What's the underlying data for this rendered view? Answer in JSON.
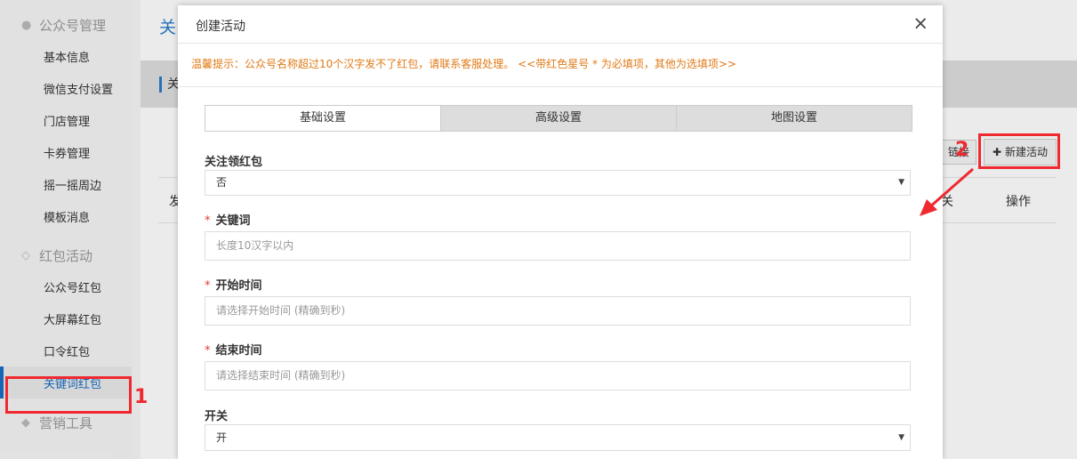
{
  "sidebar": {
    "groups": [
      {
        "label": "公众号管理",
        "items": [
          "基本信息",
          "微信支付设置",
          "门店管理",
          "卡券管理",
          "摇一摇周边",
          "模板消息"
        ]
      },
      {
        "label": "红包活动",
        "items": [
          "公众号红包",
          "大屏幕红包",
          "口令红包",
          "关键词红包"
        ]
      },
      {
        "label": "营销工具",
        "items": []
      }
    ]
  },
  "main": {
    "title": "关",
    "band_title": "关",
    "btn_link": "链接",
    "btn_new": "新建活动",
    "th_left": "发",
    "th_mid": "关",
    "th_op": "操作"
  },
  "modal": {
    "title": "创建活动",
    "close": "×",
    "notice": "温馨提示：公众号名称超过10个汉字发不了红包，请联系客服处理。 <<带红色星号 * 为必填项，其他为选填项>>",
    "tabs": [
      "基础设置",
      "高级设置",
      "地图设置"
    ],
    "active_tab": 0,
    "fields": {
      "follow": {
        "label": "关注领红包",
        "value": "否"
      },
      "keyword": {
        "label": "关键词",
        "placeholder": "长度10汉字以内"
      },
      "start": {
        "label": "开始时间",
        "placeholder": "请选择开始时间 (精确到秒)"
      },
      "end": {
        "label": "结束时间",
        "placeholder": "请选择结束时间 (精确到秒)"
      },
      "switch": {
        "label": "开关",
        "value": "开"
      }
    },
    "required_mark": "*"
  },
  "annotations": {
    "one": "1",
    "two": "2"
  },
  "colors": {
    "accent": "#2a7ac9",
    "warning": "#e07a16",
    "annotation": "#f0282f"
  }
}
